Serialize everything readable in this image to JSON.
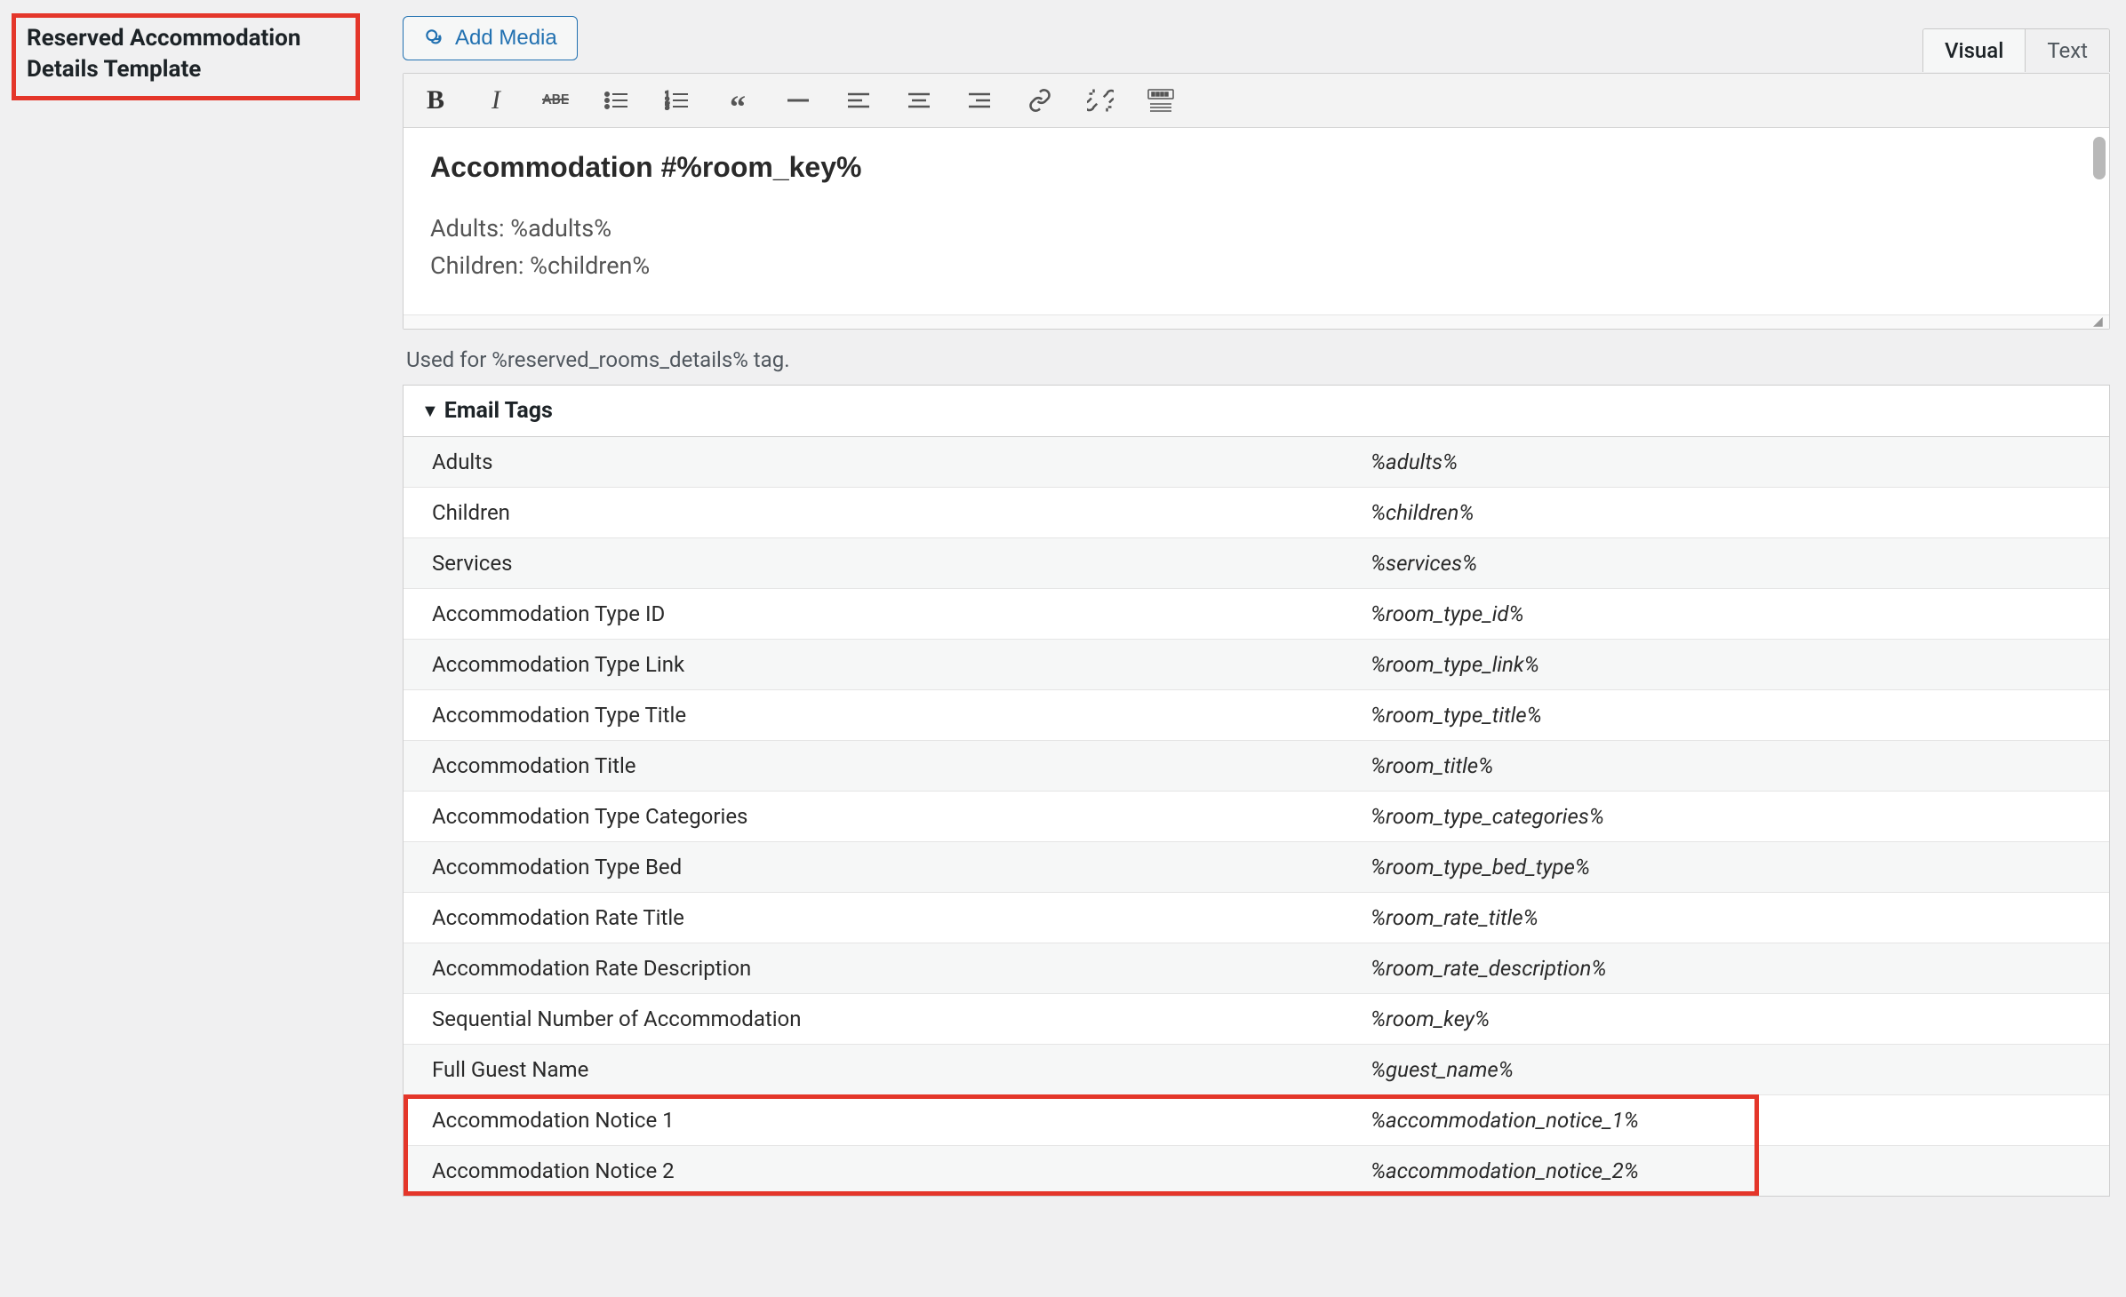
{
  "section_title": "Reserved Accommodation Details Template",
  "add_media_label": "Add Media",
  "tabs": {
    "visual": "Visual",
    "text": "Text"
  },
  "editor": {
    "heading": "Accommodation #%room_key%",
    "line_adults": "Adults: %adults%",
    "line_children": "Children: %children%"
  },
  "helper_text": "Used for %reserved_rooms_details% tag.",
  "email_tags_header": "Email Tags",
  "email_tags": [
    {
      "label": "Adults",
      "tag": "%adults%"
    },
    {
      "label": "Children",
      "tag": "%children%"
    },
    {
      "label": "Services",
      "tag": "%services%"
    },
    {
      "label": "Accommodation Type ID",
      "tag": "%room_type_id%"
    },
    {
      "label": "Accommodation Type Link",
      "tag": "%room_type_link%"
    },
    {
      "label": "Accommodation Type Title",
      "tag": "%room_type_title%"
    },
    {
      "label": "Accommodation Title",
      "tag": "%room_title%"
    },
    {
      "label": "Accommodation Type Categories",
      "tag": "%room_type_categories%"
    },
    {
      "label": "Accommodation Type Bed",
      "tag": "%room_type_bed_type%"
    },
    {
      "label": "Accommodation Rate Title",
      "tag": "%room_rate_title%"
    },
    {
      "label": "Accommodation Rate Description",
      "tag": "%room_rate_description%"
    },
    {
      "label": "Sequential Number of Accommodation",
      "tag": "%room_key%"
    },
    {
      "label": "Full Guest Name",
      "tag": "%guest_name%"
    },
    {
      "label": "Accommodation Notice 1",
      "tag": "%accommodation_notice_1%"
    },
    {
      "label": "Accommodation Notice 2",
      "tag": "%accommodation_notice_2%"
    }
  ]
}
